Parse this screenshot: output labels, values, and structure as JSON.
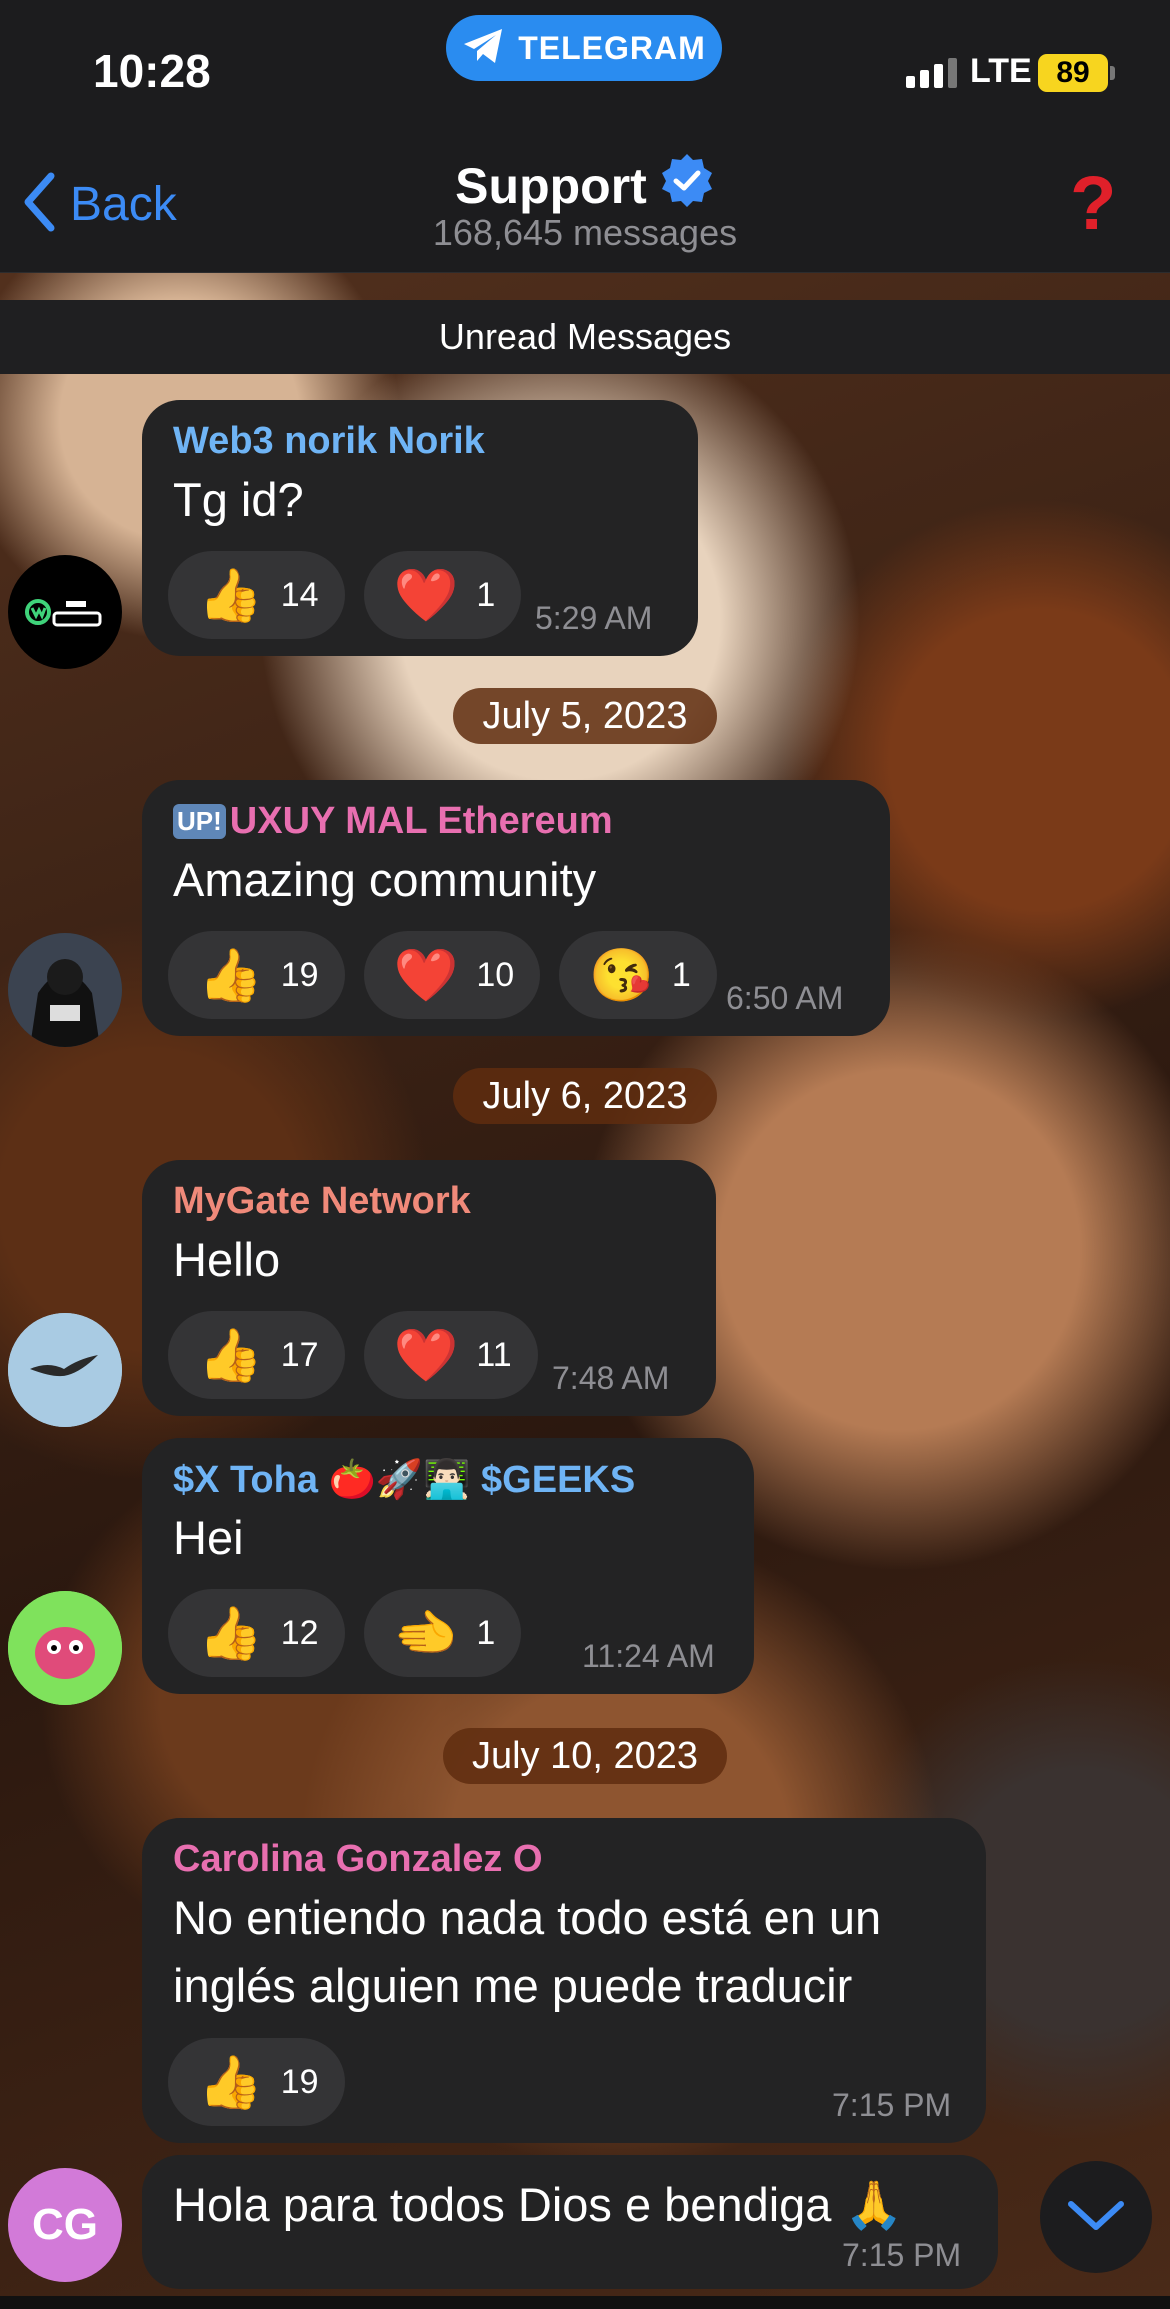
{
  "status_bar": {
    "time": "10:28",
    "banner": "TELEGRAM",
    "network": "LTE",
    "battery": "89"
  },
  "header": {
    "back_label": "Back",
    "title": "Support",
    "subtitle": "168,645 messages",
    "help_icon": "?"
  },
  "unread_label": "Unread Messages",
  "messages": [
    {
      "sender": "Web3 norik Norik",
      "text": "Tg id?",
      "time": "5:29 AM",
      "reactions": [
        {
          "emoji": "👍",
          "count": "14"
        },
        {
          "emoji": "❤️",
          "count": "1"
        }
      ]
    },
    {
      "sender": "UXUY MAL Ethereum",
      "badge": "UP!",
      "text": "Amazing community",
      "time": "6:50 AM",
      "reactions": [
        {
          "emoji": "👍",
          "count": "19"
        },
        {
          "emoji": "❤️",
          "count": "10"
        },
        {
          "emoji": "😘",
          "count": "1"
        }
      ]
    },
    {
      "sender": "MyGate Network",
      "text": "Hello",
      "time": "7:48 AM",
      "reactions": [
        {
          "emoji": "👍",
          "count": "17"
        },
        {
          "emoji": "❤️",
          "count": "11"
        }
      ]
    },
    {
      "sender": "$X Toha 🍅🚀👨🏻‍💻 $GEEKS",
      "text": "Hei",
      "time": "11:24 AM",
      "reactions": [
        {
          "emoji": "👍",
          "count": "12"
        },
        {
          "emoji": "🫲",
          "count": "1"
        }
      ]
    },
    {
      "sender": "Carolina Gonzalez O",
      "text_line1": "No entiendo nada todo está en un",
      "text_line2": "inglés alguien me puede traducir",
      "time": "7:15 PM",
      "reactions": [
        {
          "emoji": "👍",
          "count": "19"
        }
      ]
    },
    {
      "avatar_initials": "CG",
      "text": "Hola para todos Dios e bendiga 🙏",
      "time": "7:15 PM"
    }
  ],
  "dates": [
    "July 5, 2023",
    "July 6, 2023",
    "July 10, 2023"
  ],
  "colors": {
    "telegram_blue": "#2a8cf0",
    "link_blue": "#3c8bf5",
    "bubble": "#232324",
    "name_blue": "#6fb4f5",
    "name_pink": "#e86fb0",
    "name_salmon": "#f08a7a",
    "avatar_cg": "#d27ad8"
  }
}
